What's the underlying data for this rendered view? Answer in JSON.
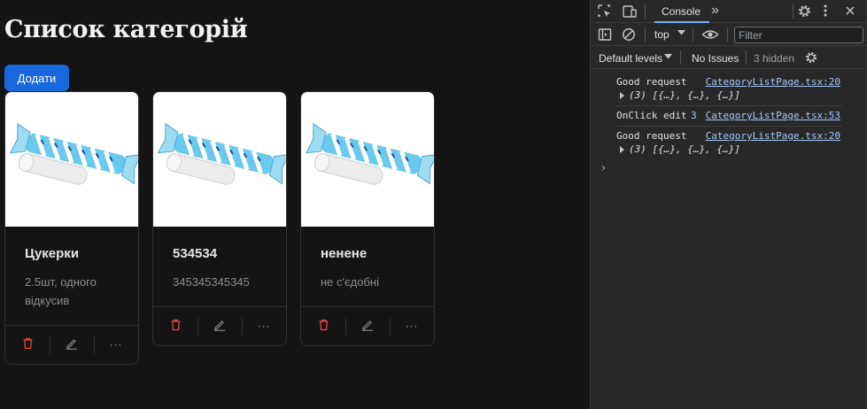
{
  "page": {
    "title": "Список категорій",
    "add_button": "Додати",
    "categories": [
      {
        "name": "Цукерки",
        "description": "2.5шт, одного відкусив"
      },
      {
        "name": "534534",
        "description": "345345345345"
      },
      {
        "name": "ненене",
        "description": "не с'єдобні"
      }
    ],
    "card_more_label": "···"
  },
  "devtools": {
    "tabs": {
      "console": "Console",
      "more": "»"
    },
    "context": "top",
    "filter_placeholder": "Filter",
    "levels": "Default levels",
    "issues": "No Issues",
    "hidden": "3 hidden",
    "logs": [
      {
        "message": "Good request",
        "source": "CategoryListPage.tsx:20",
        "object": "(3) [{…}, {…}, {…}]"
      },
      {
        "message": "OnClick edit",
        "count": "3",
        "source": "CategoryListPage.tsx:53"
      },
      {
        "message": "Good request",
        "source": "CategoryListPage.tsx:20",
        "object": "(3) [{…}, {…}, {…}]"
      }
    ],
    "prompt": "›"
  },
  "colors": {
    "accent": "#1668dc",
    "delete": "#e84749",
    "link": "#a8c7fa"
  }
}
